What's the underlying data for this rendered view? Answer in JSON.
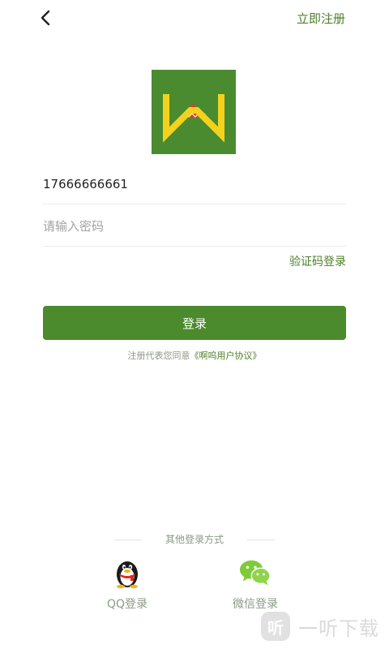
{
  "header": {
    "back_icon": "chevron-left-icon",
    "register_label": "立即注册"
  },
  "logo": {
    "icon": "app-logo-w"
  },
  "form": {
    "phone_value": "17666666661",
    "password_placeholder": "请输入密码",
    "sms_login_label": "验证码登录",
    "login_button_label": "登录"
  },
  "agreement": {
    "prefix": "注册代表您同意",
    "link_label": "《啊呜用户协议》"
  },
  "other_login": {
    "title": "其他登录方式",
    "options": [
      {
        "label": "QQ登录",
        "icon": "qq-penguin-icon"
      },
      {
        "label": "微信登录",
        "icon": "wechat-icon"
      }
    ]
  },
  "watermark": {
    "badge": "听",
    "text": "一听下载"
  },
  "colors": {
    "accent": "#4b8a2d",
    "link": "#4d7f2a",
    "muted": "#8a9a86",
    "logo_yellow": "#f3d21e",
    "logo_red": "#e8382a"
  }
}
